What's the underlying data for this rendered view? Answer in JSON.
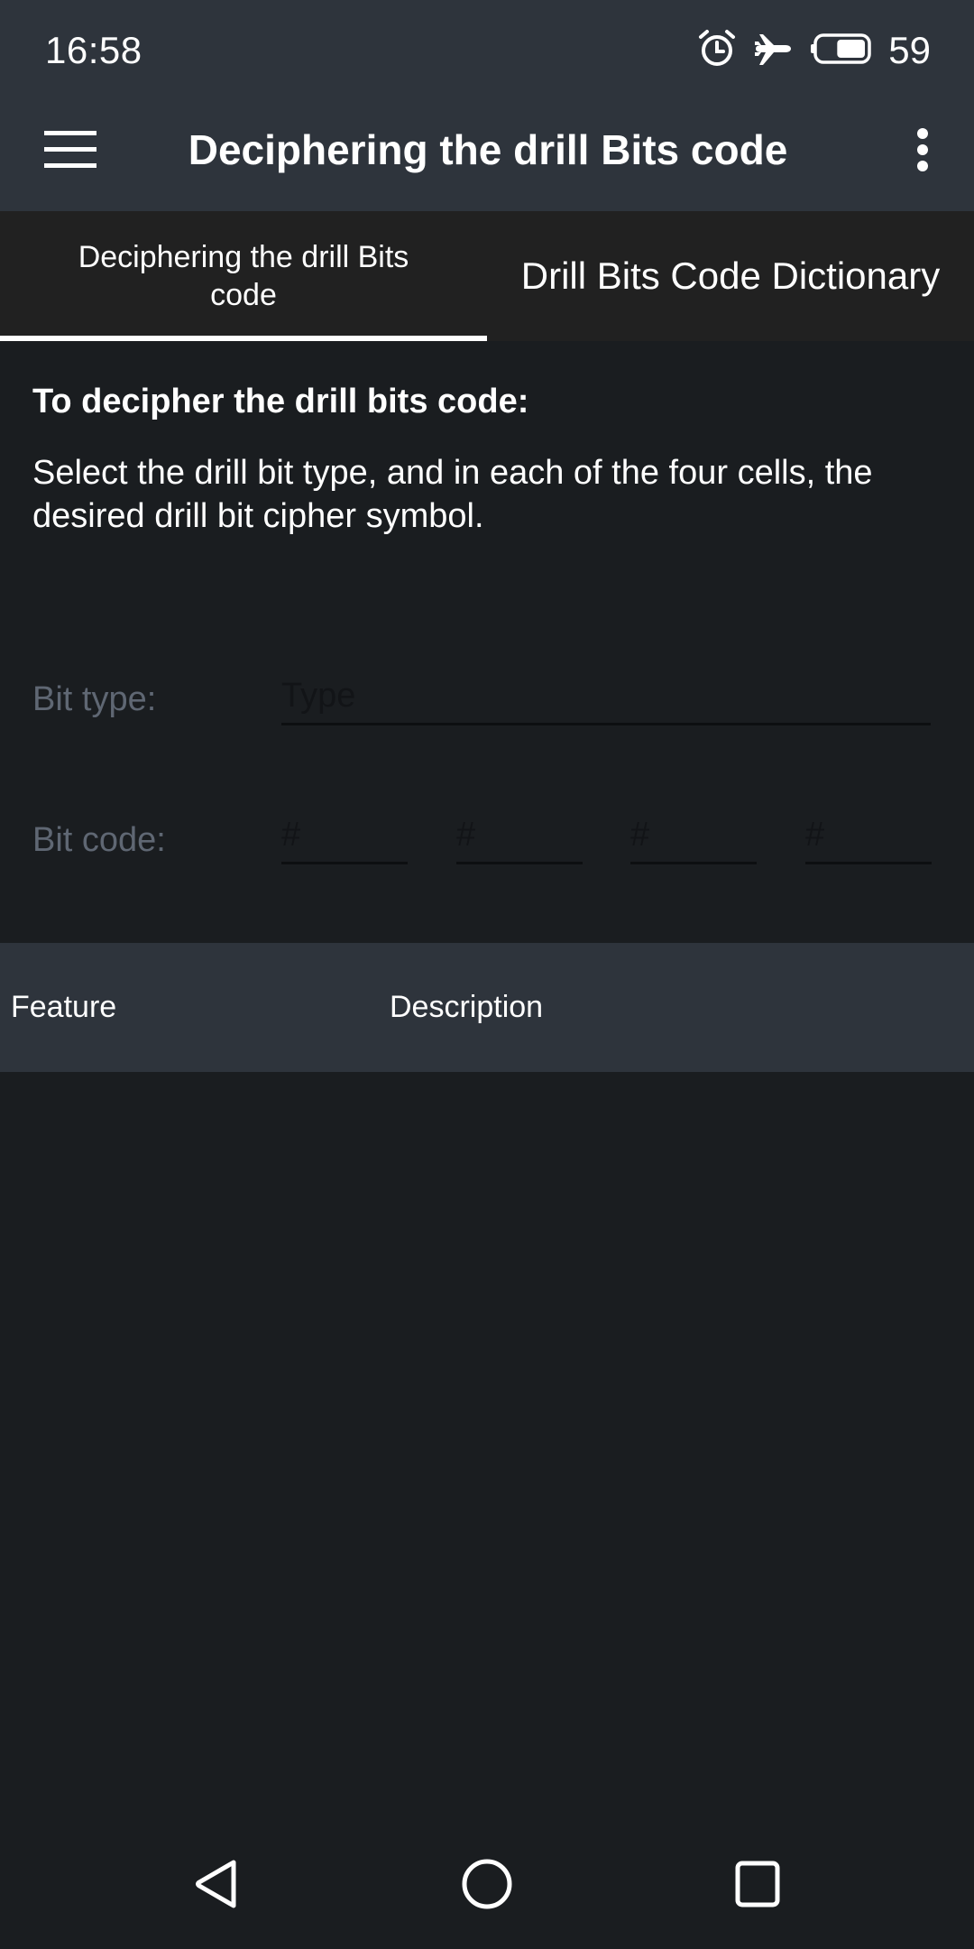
{
  "status_bar": {
    "time": "16:58",
    "icons": [
      "alarm-icon",
      "airplane-mode-icon",
      "battery-icon"
    ],
    "battery_percent": "59",
    "battery_level": 0.59
  },
  "app_bar": {
    "title": "Deciphering the drill Bits code",
    "menu_icon": "hamburger-menu-icon",
    "overflow_icon": "more-vert-icon"
  },
  "tabs": [
    {
      "label": "Deciphering the drill Bits code",
      "selected": true
    },
    {
      "label": "Drill Bits Code Dictionary",
      "selected": false
    }
  ],
  "content": {
    "heading": "To decipher the drill bits code:",
    "instructions": "Select the drill bit type, and in each of the four cells, the desired drill bit cipher symbol.",
    "bit_type": {
      "label": "Bit type:",
      "value": "",
      "placeholder": "Type"
    },
    "bit_code": {
      "label": "Bit code:",
      "cells": [
        {
          "value": "",
          "placeholder": "#"
        },
        {
          "value": "",
          "placeholder": "#"
        },
        {
          "value": "",
          "placeholder": "#"
        },
        {
          "value": "",
          "placeholder": "#"
        }
      ]
    }
  },
  "table": {
    "columns": [
      "Feature",
      "Description"
    ],
    "rows": []
  },
  "nav_bar": {
    "buttons": [
      "back-icon",
      "home-icon",
      "recents-icon"
    ]
  },
  "colors": {
    "bar_background": "#2e343c",
    "tab_background": "#212121",
    "content_background": "#1a1d20",
    "label_muted": "#5f6773",
    "indicator": "#ffffff"
  }
}
